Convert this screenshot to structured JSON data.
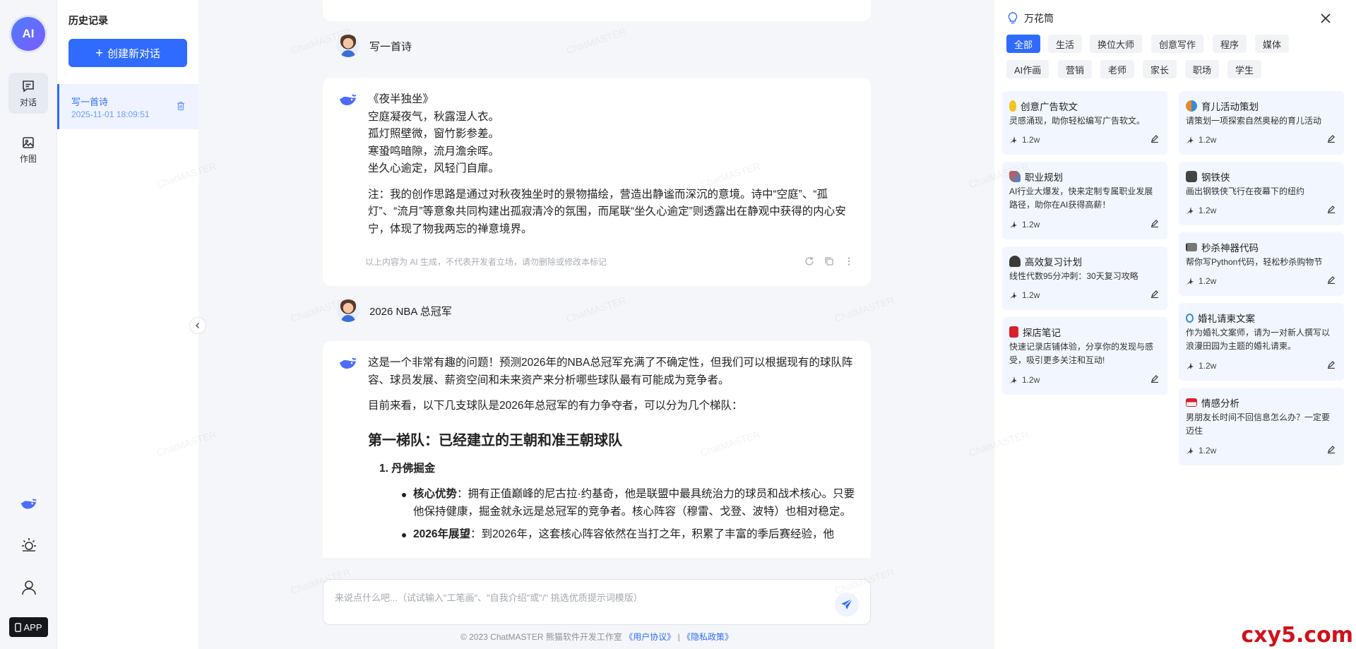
{
  "rail": {
    "logo": "AI",
    "nav": [
      {
        "label": "对话",
        "icon": "chat-icon",
        "active": true
      },
      {
        "label": "作图",
        "icon": "image-icon",
        "active": false
      }
    ],
    "app_label": "APP"
  },
  "history": {
    "title": "历史记录",
    "new_chat_label": "创建新对话",
    "items": [
      {
        "title": "写一首诗",
        "time": "2025-11-01 18:09:51"
      }
    ]
  },
  "chat": {
    "messages": [
      {
        "role": "user",
        "text": "写一首诗"
      },
      {
        "role": "bot",
        "poem": [
          "《夜半独坐》",
          "空庭凝夜气，秋露湿人衣。",
          "孤灯照壁微，窗竹影参差。",
          "寒蛩鸣暗隙，流月澹余晖。",
          "坐久心逾定，风轻门自扉。"
        ],
        "note": "注：我的创作思路是通过对秋夜独坐时的景物描绘，营造出静谧而深沉的意境。诗中“空庭”、“孤灯”、“流月”等意象共同构建出孤寂清冷的氛围，而尾联“坐久心逾定”则透露出在静观中获得的内心安宁，体现了物我两忘的禅意境界。",
        "disclaimer": "以上内容为 AI 生成，不代表开发者立场，请勿删除或修改本标记"
      },
      {
        "role": "user",
        "text": "2026 NBA 总冠军"
      },
      {
        "role": "bot",
        "intro": "这是一个非常有趣的问题！预测2026年的NBA总冠军充满了不确定性，但我们可以根据现有的球队阵容、球员发展、薪资空间和未来资产来分析哪些球队最有可能成为竞争者。",
        "lead": "目前来看，以下几支球队是2026年总冠军的有力争夺者，可以分为几个梯队：",
        "heading": "第一梯队：已经建立的王朝和准王朝球队",
        "list_title": "1. 丹佛掘金",
        "bullets": [
          {
            "label": "核心优势",
            "text": "：拥有正值巅峰的尼古拉·约基奇，他是联盟中最具统治力的球员和战术核心。只要他保持健康，掘金就永远是总冠军的竞争者。核心阵容（穆雷、戈登、波特）也相对稳定。"
          },
          {
            "label": "2026年展望",
            "text": "：到2026年，这套核心阵容依然在当打之年，积累了丰富的季后赛经验，他"
          }
        ]
      }
    ],
    "input_placeholder": "来说点什么吧...（试试输入\"工笔画\"、\"自我介绍\"或\"/\" 挑选优质提示词模版）"
  },
  "footer": {
    "copyright": "© 2023 ChatMASTER 熊猫软件开发工作室",
    "user_agreement": "《用户协议》",
    "separator": "|",
    "privacy": "《隐私政策》"
  },
  "right_panel": {
    "title": "万花筒",
    "tags": [
      "全部",
      "生活",
      "换位大师",
      "创意写作",
      "程序",
      "媒体",
      "AI作画",
      "营销",
      "老师",
      "家长",
      "职场",
      "学生"
    ],
    "cards_left": [
      {
        "title": "创意广告软文",
        "desc": "灵感涌现，助你轻松编写广告软文。",
        "count": "1.2w",
        "icon": "bulb-icon",
        "color": "#f3c31f"
      },
      {
        "title": "职业规划",
        "desc": "AI行业大爆发，快来定制专属职业发展路径，助你在AI获得高薪！",
        "count": "1.2w",
        "icon": "rocket-icon",
        "color": "#e2513c"
      },
      {
        "title": "高效复习计划",
        "desc": "线性代数95分冲刺：30天复习攻略",
        "count": "1.2w",
        "icon": "student-icon",
        "color": "#3a3a3a"
      },
      {
        "title": "探店笔记",
        "desc": "快速记录店铺体验，分享你的发现与感受，吸引更多关注和互动!",
        "count": "1.2w",
        "icon": "book-icon",
        "color": "#d8212d"
      }
    ],
    "cards_right": [
      {
        "title": "育儿活动策划",
        "desc": "请策划一项探索自然奥秘的育儿活动",
        "count": "1.2w",
        "icon": "family-icon",
        "color": "#e58a2c"
      },
      {
        "title": "钢铁侠",
        "desc": "画出钢铁侠飞行在夜幕下的纽约",
        "count": "1.2w",
        "icon": "robot-icon",
        "color": "#444"
      },
      {
        "title": "秒杀神器代码",
        "desc": "帮你写Python代码，轻松秒杀购物节",
        "count": "1.2w",
        "icon": "flag-icon",
        "color": "#333"
      },
      {
        "title": "婚礼请柬文案",
        "desc": "作为婚礼文案师，请为一对新人撰写以浪漫田园为主题的婚礼请柬。",
        "count": "1.2w",
        "icon": "ring-icon",
        "color": "#3b8ad8"
      },
      {
        "title": "情感分析",
        "desc": "男朋友长时间不回信息怎么办？一定要迈住",
        "count": "1.2w",
        "icon": "mail-icon",
        "color": "#d8212d"
      }
    ]
  },
  "watermark": "ChatMASTER",
  "corner_logo": "cxy5.com"
}
